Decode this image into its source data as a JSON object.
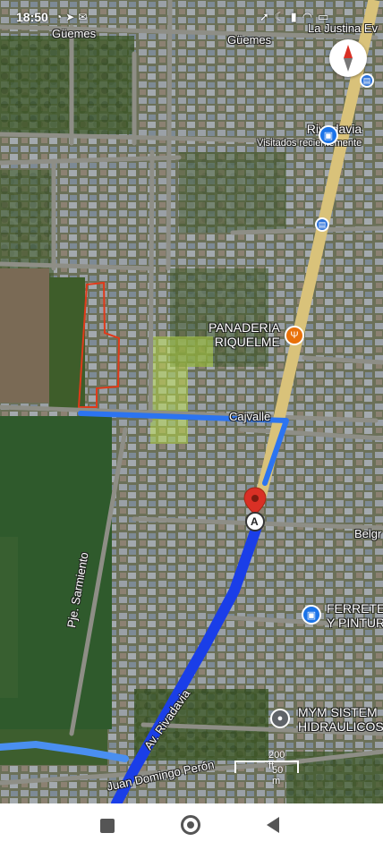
{
  "status_bar": {
    "time": "18:50",
    "left_icons": [
      "whatsapp-icon",
      "location-icon",
      "gmail-icon"
    ],
    "right_icons": [
      "navigation-icon",
      "moon-icon",
      "signal-icon",
      "wifi-icon",
      "battery-icon"
    ]
  },
  "map": {
    "streets": {
      "guemes_left": "Güemes",
      "guemes_right": "Güemes",
      "la_justina": "La Justina Ev",
      "cajvalle": "Cajvalle",
      "belgrano": "Belgr",
      "pje_sarmiento": "Pje. Sarmiento",
      "av_rivadavia": "Av. Rivadavia",
      "juan_domingo_peron": "Juan Domingo Perón"
    },
    "pois": {
      "rivadavia": {
        "name": "Rivadavia",
        "sub": "Visitados recientemente",
        "icon": "shopping-bag-icon"
      },
      "panaderia": {
        "name_line1": "PANADERIA",
        "name_line2": "RIQUELME",
        "icon": "restaurant-icon"
      },
      "ferreteria": {
        "name_line1": "FERRETE",
        "name_line2": "Y PINTUR",
        "icon": "shopping-bag-icon"
      },
      "mym": {
        "name_line1": "MYM SISTEM",
        "name_line2": "HIDRAULICOS",
        "icon": "location-pin-icon"
      }
    },
    "marker_label": "A",
    "scale": {
      "ft": "200 ft",
      "m": "50 m"
    },
    "colors": {
      "route_primary": "#1a3ee8",
      "route_secondary": "#4a8ff0",
      "road_major": "#d9c27a",
      "parcel_outline": "#e03a1a",
      "marker": "#d93025"
    }
  },
  "nav_bar": {
    "buttons": [
      "recents-button",
      "home-button",
      "back-button"
    ]
  }
}
